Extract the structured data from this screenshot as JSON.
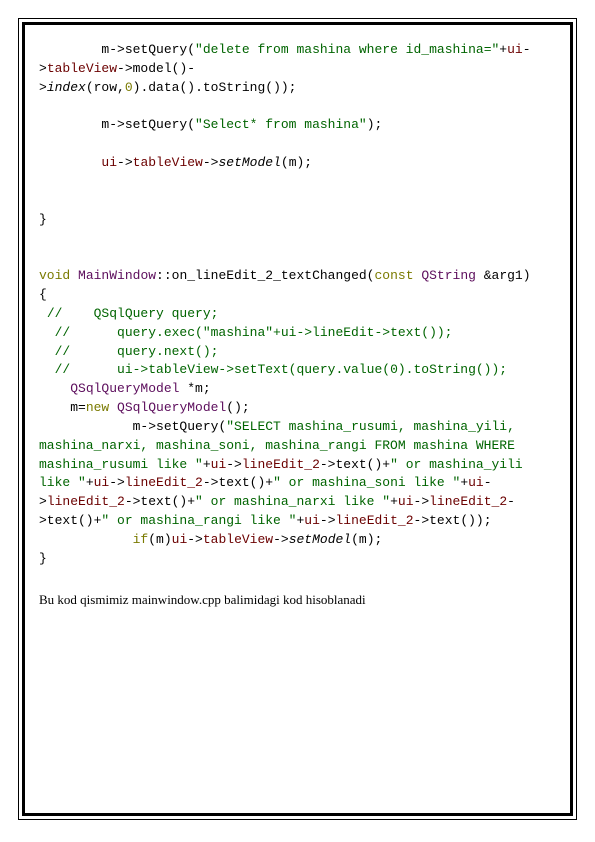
{
  "blockA": {
    "l1a": "        m->setQuery(",
    "l1b": "\"delete from mashina where id_mashina=\"",
    "l1c": "+",
    "l1d": "ui",
    "l1e": "->",
    "l1f": "tableView",
    "l1g": "->model()-",
    "l2a": ">",
    "l2b": "index",
    "l2c": "(row,",
    "l2d": "0",
    "l2e": ").data().toString());",
    "l3a": "        m->setQuery(",
    "l3b": "\"Select* from mashina\"",
    "l3c": ");",
    "l4a": "        ",
    "l4b": "ui",
    "l4c": "->",
    "l4d": "tableView",
    "l4e": "->",
    "l4f": "setModel",
    "l4g": "(m);",
    "close": "}"
  },
  "sig": {
    "a": "void",
    "b": " ",
    "c": "MainWindow",
    "d": "::on_lineEdit_2_textChanged(",
    "e": "const",
    "f": " ",
    "g": "QString",
    "h": " &arg1)"
  },
  "body": {
    "open": "{",
    "c1": " //    QSqlQuery query;",
    "c2": "  //      query.exec(\"mashina\"+ui->lineEdit->text());",
    "c3": "  //      query.next();",
    "c4": "  //      ui->tableView->setText(query.value(0).toString());",
    "m1a": "    ",
    "m1b": "QSqlQueryModel",
    "m1c": " *m;",
    "m2a": "    m=",
    "m2b": "new",
    "m2c": " ",
    "m2d": "QSqlQueryModel",
    "m2e": "();",
    "q1a": "            m->setQuery(",
    "q1b": "\"SELECT mashina_rusumi, mashina_yili, mashina_narxi, mashina_soni, mashina_rangi FROM mashina WHERE  mashina_rusumi like \"",
    "q1c": "+",
    "q1d": "ui",
    "q1e": "->",
    "q1f": "lineEdit_2",
    "q1g": "->text()+",
    "q1h": "\" or mashina_yili like \"",
    "q2c": "+",
    "q2d": "ui",
    "q2e": "->",
    "q2f": "lineEdit_2",
    "q2g": "->text()+",
    "q2h": "\" or mashina_soni like \"",
    "q3c": "+",
    "q3d": "ui",
    "q3e": "->",
    "q3f": "lineEdit_2",
    "q3g": "->text()+",
    "q3h": "\" or mashina_narxi like \"",
    "q4c": "+",
    "q4d": "ui",
    "q4e": "->",
    "q4f": "lineEdit_2",
    "q4g": "->text()+",
    "q4h": "\" or mashina_rangi like \"",
    "q5c": "+",
    "q5d": "ui",
    "q5e": "->",
    "q5f": "lineEdit_2",
    "q5g": "->text());",
    "if1a": "            ",
    "if1b": "if",
    "if1c": "(m)",
    "if1d": "ui",
    "if1e": "->",
    "if1f": "tableView",
    "if1g": "->",
    "if1h": "setModel",
    "if1i": "(m);",
    "close": "}"
  },
  "caption": "Bu kod qismimiz mainwindow.cpp balimidagi kod hisoblanadi"
}
